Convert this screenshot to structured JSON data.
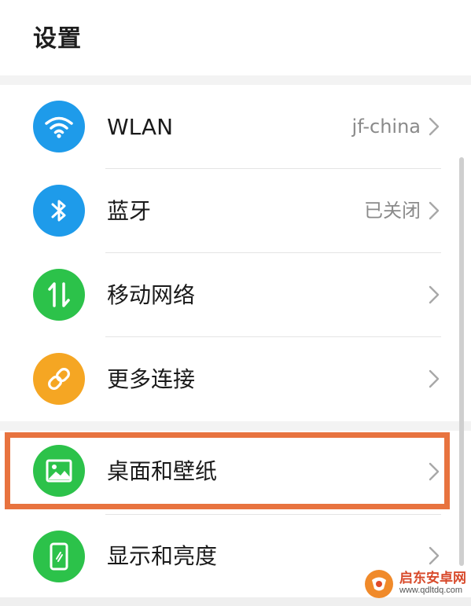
{
  "header": {
    "title": "设置"
  },
  "colors": {
    "blue": "#1e9bea",
    "green": "#2cc24a",
    "orange": "#f5a623",
    "highlight": "#e8733f",
    "value_text": "#8a8a8a"
  },
  "rows": [
    {
      "label": "WLAN",
      "value": "jf-china",
      "icon": "wifi-icon"
    },
    {
      "label": "蓝牙",
      "value": "已关闭",
      "icon": "bluetooth-icon"
    },
    {
      "label": "移动网络",
      "value": "",
      "icon": "mobile-data-icon"
    },
    {
      "label": "更多连接",
      "value": "",
      "icon": "link-icon"
    },
    {
      "label": "桌面和壁纸",
      "value": "",
      "icon": "image-icon"
    },
    {
      "label": "显示和亮度",
      "value": "",
      "icon": "phone-display-icon"
    }
  ],
  "watermark": {
    "name": "启东安卓网",
    "url": "www.qdltdq.com"
  }
}
